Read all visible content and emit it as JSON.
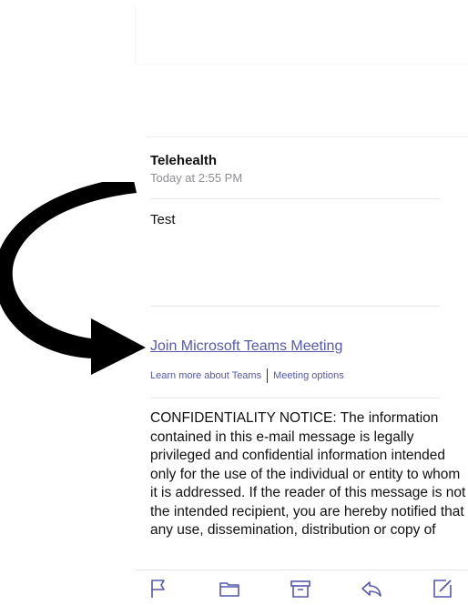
{
  "email": {
    "sender": "Telehealth",
    "timestamp": "Today at 2:55 PM",
    "body": "Test",
    "teams_link": "Join Microsoft Teams Meeting",
    "learn_more": "Learn more about Teams",
    "meeting_options": "Meeting options",
    "notice": "CONFIDENTIALITY NOTICE: The information contained in this e-mail message is legally privileged and confidential information intended only for the use of the individual or entity to whom it is addressed. If the reader of this message is not the intended recipient, you are hereby notified that any use, dissemination, distribution or copy of"
  },
  "toolbar": {
    "accent": "#5558af",
    "icons": [
      "flag-icon",
      "folder-icon",
      "archive-icon",
      "reply-icon",
      "compose-icon"
    ]
  },
  "annotation": {
    "arrow_color": "#000000"
  }
}
